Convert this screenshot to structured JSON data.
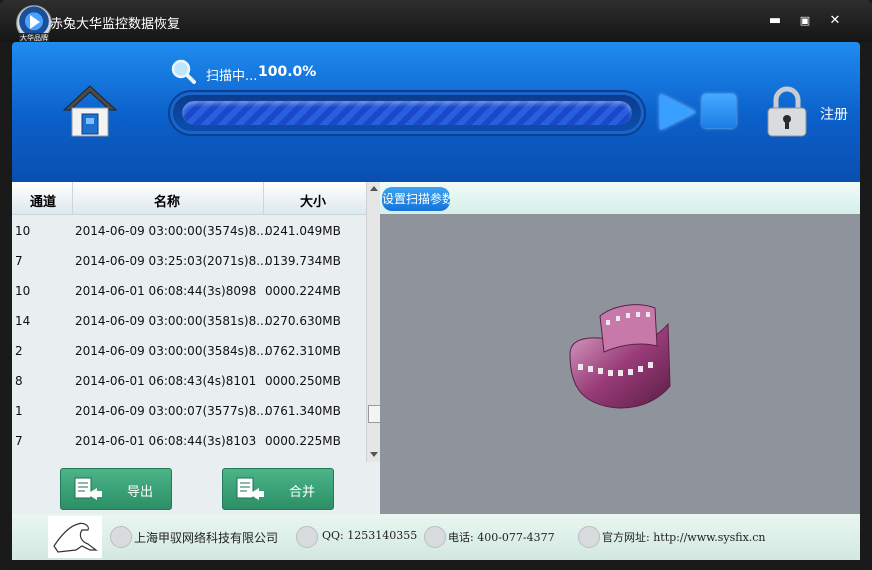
{
  "window": {
    "title": "赤兔大华监控数据恢复",
    "logo_tag": "大华品牌",
    "controls": {
      "minimize": "▬",
      "maximize": "▣",
      "close": "✕"
    }
  },
  "header": {
    "scan_label": "扫描中...",
    "scan_percent": "100.0%",
    "progress": 1.0,
    "register_label": "注册"
  },
  "table": {
    "headers": {
      "channel": "通道",
      "name": "名称",
      "size": "大小"
    },
    "rows": [
      {
        "channel": "10",
        "name": "2014-06-09 03:00:00(3574s)8...",
        "size": "0241.049MB"
      },
      {
        "channel": "7",
        "name": "2014-06-09 03:25:03(2071s)8...",
        "size": "0139.734MB"
      },
      {
        "channel": "10",
        "name": "2014-06-01 06:08:44(3s)8098",
        "size": "0000.224MB"
      },
      {
        "channel": "14",
        "name": "2014-06-09 03:00:00(3581s)8...",
        "size": "0270.630MB"
      },
      {
        "channel": "2",
        "name": "2014-06-09 03:00:00(3584s)8...",
        "size": "0762.310MB"
      },
      {
        "channel": "8",
        "name": "2014-06-01 06:08:43(4s)8101",
        "size": "0000.250MB"
      },
      {
        "channel": "1",
        "name": "2014-06-09 03:00:07(3577s)8...",
        "size": "0761.340MB"
      },
      {
        "channel": "7",
        "name": "2014-06-01 06:08:44(3s)8103",
        "size": "0000.225MB"
      }
    ]
  },
  "buttons": {
    "export": "导出",
    "merge": "合并"
  },
  "right_panel": {
    "param_button": "设置扫描参数"
  },
  "footer": {
    "company": "上海甲驭网络科技有限公司",
    "qq": "QQ: 1253140355",
    "phone": "电话: 400-077-4377",
    "website": "官方网址: http://www.sysfix.cn"
  },
  "colors": {
    "accent": "#0b5fc9",
    "button_green": "#2c8f66",
    "progress": "#2a5ee0"
  }
}
